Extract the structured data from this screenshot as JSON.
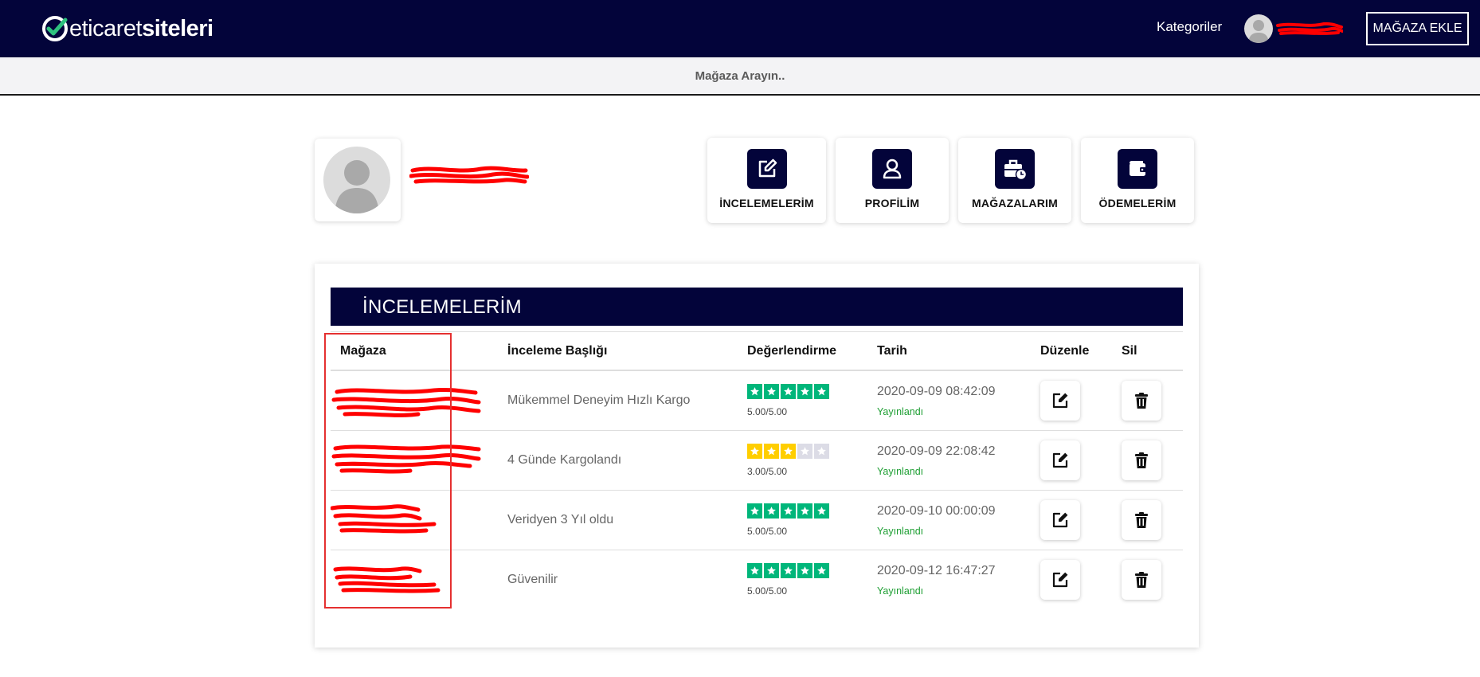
{
  "brand": {
    "name_light": "eticaret",
    "name_bold": "siteleri",
    "logo_icon": "check-circle-icon",
    "accent_color": "#03043a",
    "logo_check_color": "#2ec27e"
  },
  "nav": {
    "categories_label": "Kategoriler",
    "avatar_icon": "user-avatar-icon",
    "add_store_label": "MAĞAZA EKLE"
  },
  "search": {
    "placeholder": "Mağaza Arayın.."
  },
  "actions": [
    {
      "label": "İNCELEMELERİM",
      "icon": "edit-icon"
    },
    {
      "label": "PROFİLİM",
      "icon": "user-icon"
    },
    {
      "label": "MAĞAZALARIM",
      "icon": "briefcase-clock-icon"
    },
    {
      "label": "ÖDEMELERİM",
      "icon": "wallet-icon"
    }
  ],
  "reviews": {
    "title": "İNCELEMELERİM",
    "columns": {
      "store": "Mağaza",
      "review_title": "İnceleme Başlığı",
      "rating": "Değerlendirme",
      "date": "Tarih",
      "edit": "Düzenle",
      "delete": "Sil"
    },
    "rows": [
      {
        "title": "Mükemmel Deneyim Hızlı Kargo",
        "stars": 5,
        "score": "5.00/5.00",
        "date": "2020-09-09 08:42:09",
        "status": "Yayınlandı"
      },
      {
        "title": "4 Günde Kargolandı",
        "stars": 3,
        "score": "3.00/5.00",
        "date": "2020-09-09 22:08:42",
        "status": "Yayınlandı"
      },
      {
        "title": "Veridyen 3 Yıl oldu",
        "stars": 5,
        "score": "5.00/5.00",
        "date": "2020-09-10 00:00:09",
        "status": "Yayınlandı"
      },
      {
        "title": "Güvenilir",
        "stars": 5,
        "score": "5.00/5.00",
        "date": "2020-09-12 16:47:27",
        "status": "Yayınlandı"
      }
    ]
  },
  "colors": {
    "star_high": "#00b67a",
    "star_mid": "#ffce00",
    "star_empty": "#dcdce6",
    "status_published": "#1e9e33",
    "redaction": "#ff0000",
    "highlight_box": "#e53030"
  }
}
